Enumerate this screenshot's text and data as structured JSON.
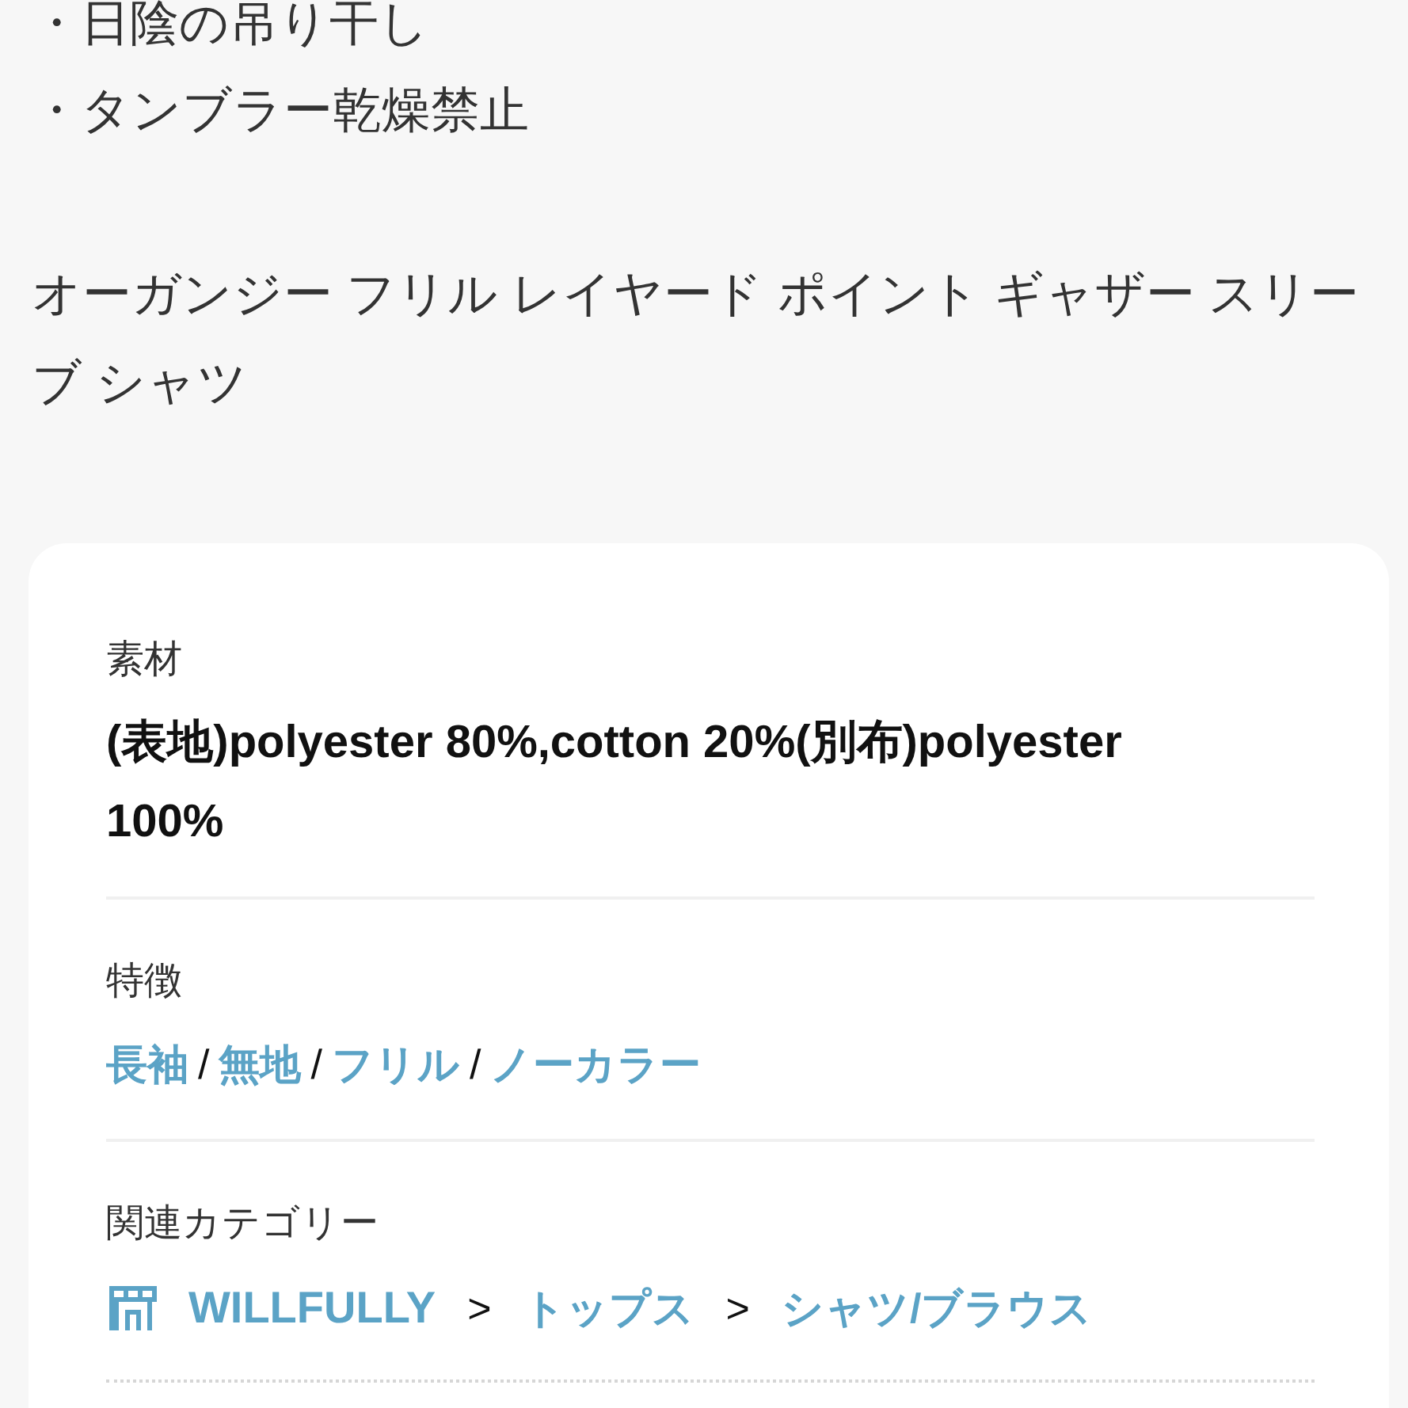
{
  "care_list": [
    "・日陰の吊り干し",
    "・タンブラー乾燥禁止"
  ],
  "product_name": "オーガンジー フリル レイヤード ポイント ギャザー スリーブ シャツ",
  "spec_card": {
    "sections": [
      {
        "kind": "text",
        "label": "素材",
        "value": "(表地)polyester 80%,cotton 20%(別布)polyester 100%"
      },
      {
        "kind": "links",
        "label": "特徴",
        "items": [
          {
            "kind": "link",
            "text": "長袖"
          },
          {
            "kind": "separator",
            "text": "/"
          },
          {
            "kind": "link",
            "text": "無地"
          },
          {
            "kind": "separator",
            "text": "/"
          },
          {
            "kind": "link",
            "text": "フリル"
          },
          {
            "kind": "separator",
            "text": "/"
          },
          {
            "kind": "link",
            "text": "ノーカラー"
          }
        ]
      },
      {
        "kind": "breadcrumb",
        "label": "関連カテゴリー",
        "items": [
          {
            "kind": "shop",
            "text": "WILLFULLY"
          },
          {
            "kind": "separator",
            "text": ">"
          },
          {
            "kind": "link",
            "text": "トップス"
          },
          {
            "kind": "separator",
            "text": ">"
          },
          {
            "kind": "link",
            "text": "シャツ/ブラウス"
          }
        ]
      }
    ]
  }
}
